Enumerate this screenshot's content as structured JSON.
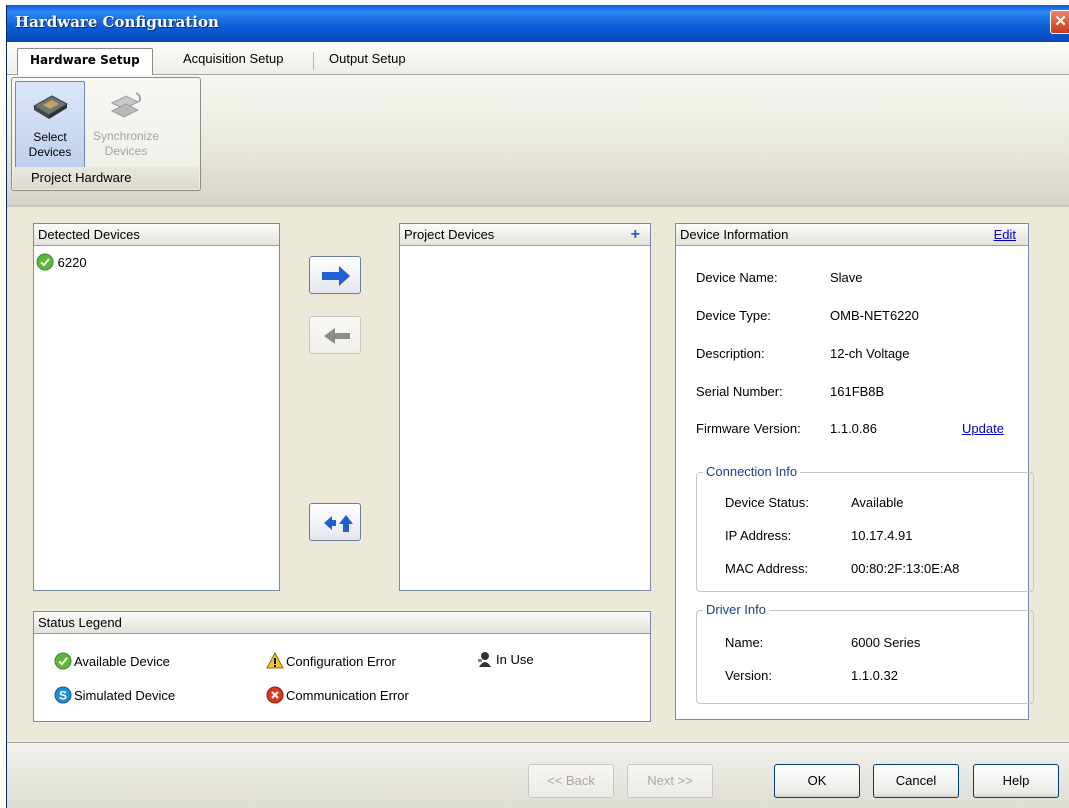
{
  "window": {
    "title": "Hardware Configuration",
    "close_label": "✕"
  },
  "tabs": [
    {
      "label": "Hardware Setup"
    },
    {
      "label": "Acquisition Setup"
    },
    {
      "label": "Output Setup"
    }
  ],
  "ribbon": {
    "group_label": "Project Hardware",
    "buttons": [
      {
        "label_line1": "Select",
        "label_line2": "Devices",
        "icon": "device-chip-icon"
      },
      {
        "label_line1": "Synchronize",
        "label_line2": "Devices",
        "icon": "sync-devices-icon"
      }
    ]
  },
  "detected": {
    "header": "Detected Devices",
    "items": [
      {
        "label": "6220",
        "status": "available"
      }
    ]
  },
  "project": {
    "header": "Project Devices",
    "add_label": "+"
  },
  "info": {
    "header": "Device Information",
    "edit_label": "Edit",
    "rows": [
      {
        "label": "Device Name:",
        "value": "Slave"
      },
      {
        "label": "Device Type:",
        "value": "OMB-NET6220"
      },
      {
        "label": "Description:",
        "value": "12-ch Voltage"
      },
      {
        "label": "Serial Number:",
        "value": "161FB8B"
      },
      {
        "label": "Firmware Version:",
        "value": "1.1.0.86"
      }
    ],
    "update_label": "Update",
    "connection": {
      "title": "Connection Info",
      "rows": [
        {
          "label": "Device Status:",
          "value": "Available"
        },
        {
          "label": "IP Address:",
          "value": "10.17.4.91"
        },
        {
          "label": "MAC Address:",
          "value": "00:80:2F:13:0E:A8"
        }
      ]
    },
    "driver": {
      "title": "Driver Info",
      "rows": [
        {
          "label": "Name:",
          "value": "6000 Series"
        },
        {
          "label": "Version:",
          "value": "1.1.0.32"
        }
      ]
    }
  },
  "legend": {
    "header": "Status Legend",
    "items": [
      {
        "label": "Available Device",
        "icon": "check-circle-icon"
      },
      {
        "label": "Configuration Error",
        "icon": "warning-icon"
      },
      {
        "label": "In Use",
        "icon": "user-in-use-icon"
      },
      {
        "label": "Simulated Device",
        "icon": "simulated-s-icon"
      },
      {
        "label": "Communication Error",
        "icon": "error-x-icon"
      }
    ]
  },
  "footer": {
    "back_label": "<< Back",
    "next_label": "Next >>",
    "ok_label": "OK",
    "cancel_label": "Cancel",
    "help_label": "Help"
  },
  "colors": {
    "titlebar": "#0b5cd6",
    "accent_blue": "#1f5fd0",
    "panel_border": "#7a8ba8",
    "link": "#0000cc",
    "available_green": "#5cb83a",
    "error_red": "#d9381e"
  }
}
